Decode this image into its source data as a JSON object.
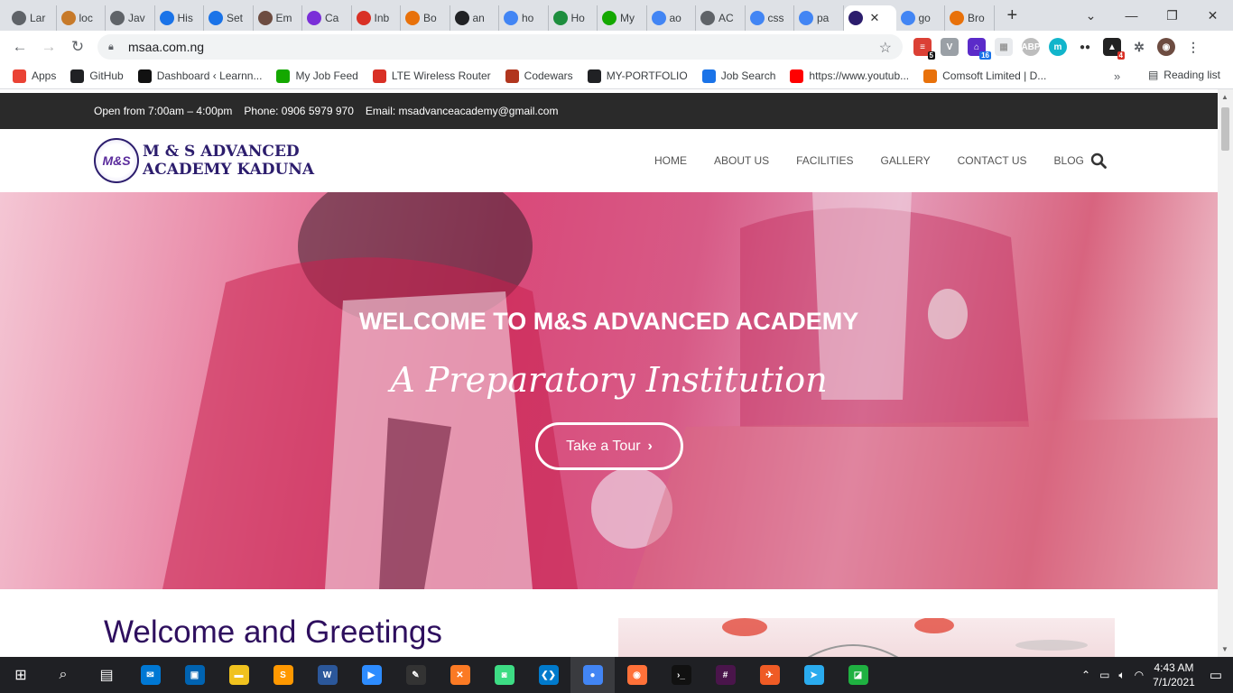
{
  "browser": {
    "tabs": [
      {
        "label": "Lar",
        "color": "#5f6368",
        "icon": "globe-icon"
      },
      {
        "label": "loc",
        "color": "#c77a2a",
        "icon": "pma-icon"
      },
      {
        "label": "Jav",
        "color": "#5f6368",
        "icon": "globe-icon"
      },
      {
        "label": "His",
        "color": "#1a73e8",
        "icon": "history-icon"
      },
      {
        "label": "Set",
        "color": "#1a73e8",
        "icon": "gear-icon"
      },
      {
        "label": "Em",
        "color": "#6d4c41",
        "icon": "avatar-icon"
      },
      {
        "label": "Ca",
        "color": "#7a2fd8",
        "icon": "bootstrap-icon"
      },
      {
        "label": "Inb",
        "color": "#d93025",
        "icon": "gmail-icon"
      },
      {
        "label": "Bo",
        "color": "#e8710a",
        "icon": "xampp-icon"
      },
      {
        "label": "an",
        "color": "#202124",
        "icon": "github-icon"
      },
      {
        "label": "ho",
        "color": "#4285f4",
        "icon": "google-icon"
      },
      {
        "label": "Ho",
        "color": "#1e8e3e",
        "icon": "w3-icon"
      },
      {
        "label": "My",
        "color": "#14a800",
        "icon": "upwork-icon"
      },
      {
        "label": "ao",
        "color": "#4285f4",
        "icon": "google-icon"
      },
      {
        "label": "AC",
        "color": "#5f6368",
        "icon": "globe-icon"
      },
      {
        "label": "css",
        "color": "#4285f4",
        "icon": "google-icon"
      },
      {
        "label": "pa",
        "color": "#4285f4",
        "icon": "google-icon"
      },
      {
        "label": "",
        "color": "#2c1d6d",
        "icon": "msaa-icon",
        "active": true
      },
      {
        "label": "go",
        "color": "#4285f4",
        "icon": "google-icon"
      },
      {
        "label": "Bro",
        "color": "#e8710a",
        "icon": "puzzle-icon"
      }
    ],
    "url": "msaa.com.ng",
    "bookmarks": [
      {
        "label": "Apps",
        "icon": "apps-grid-icon",
        "color": "#ea4335"
      },
      {
        "label": "GitHub",
        "icon": "github-icon",
        "color": "#202124"
      },
      {
        "label": "Dashboard ‹ Learnn...",
        "icon": "n-icon",
        "color": "#111"
      },
      {
        "label": "My Job Feed",
        "icon": "upwork-icon",
        "color": "#14a800"
      },
      {
        "label": "LTE Wireless Router",
        "icon": "router-icon",
        "color": "#d93025"
      },
      {
        "label": "Codewars",
        "icon": "codewars-icon",
        "color": "#b1361e"
      },
      {
        "label": "MY-PORTFOLIO",
        "icon": "portfolio-icon",
        "color": "#202124"
      },
      {
        "label": "Job Search",
        "icon": "x-icon",
        "color": "#1a73e8"
      },
      {
        "label": "https://www.youtub...",
        "icon": "youtube-icon",
        "color": "#ff0000"
      },
      {
        "label": "Comsoft Limited | D...",
        "icon": "comsoft-icon",
        "color": "#e8710a"
      }
    ],
    "bookmarks_more": "»",
    "reading_list": "Reading list",
    "extension_badges": {
      "todoist": "5",
      "library": "16",
      "notifications": "4"
    }
  },
  "site": {
    "topbar": {
      "hours": "Open from 7:00am – 4:00pm",
      "phone": "Phone: 0906 5979 970",
      "email": "Email: msadvanceacademy@gmail.com"
    },
    "logo_line1": "M & S ADVANCED",
    "logo_line2": "ACADEMY KADUNA",
    "logo_badge": "M&S",
    "menu": [
      "HOME",
      "ABOUT US",
      "FACILITIES",
      "GALLERY",
      "CONTACT US",
      "BLOG"
    ],
    "hero_title": "WELCOME TO M&S ADVANCED ACADEMY",
    "hero_subtitle": "A Preparatory Institution",
    "hero_button": "Take a Tour",
    "greeting_heading": "Welcome and Greetings",
    "accent_color": "#2e0f5e",
    "hero_color": "#d94a7a"
  },
  "taskbar": {
    "apps": [
      {
        "name": "mail",
        "color": "#0078d4",
        "glyph": "✉"
      },
      {
        "name": "store",
        "color": "#0063b1",
        "glyph": "▣"
      },
      {
        "name": "explorer",
        "color": "#f0c21e",
        "glyph": "▬"
      },
      {
        "name": "sublime",
        "color": "#ff9800",
        "glyph": "S"
      },
      {
        "name": "word",
        "color": "#2b579a",
        "glyph": "W"
      },
      {
        "name": "zoom",
        "color": "#2d8cff",
        "glyph": "▶"
      },
      {
        "name": "inkscape",
        "color": "#333",
        "glyph": "✎"
      },
      {
        "name": "xampp",
        "color": "#fb7a24",
        "glyph": "✕"
      },
      {
        "name": "android",
        "color": "#3ddc84",
        "glyph": "◙"
      },
      {
        "name": "vscode",
        "color": "#007acc",
        "glyph": "❮❯"
      },
      {
        "name": "chrome",
        "color": "#4285f4",
        "glyph": "●",
        "active": true
      },
      {
        "name": "firefox",
        "color": "#ff7139",
        "glyph": "◉"
      },
      {
        "name": "terminal",
        "color": "#111",
        "glyph": "›_"
      },
      {
        "name": "slack",
        "color": "#4a154b",
        "glyph": "#"
      },
      {
        "name": "postman",
        "color": "#ef5b25",
        "glyph": "✈"
      },
      {
        "name": "telegram",
        "color": "#2aabee",
        "glyph": "➤"
      },
      {
        "name": "greenshot",
        "color": "#1fb141",
        "glyph": "◪"
      }
    ],
    "time": "4:43 AM",
    "date": "7/1/2021"
  }
}
